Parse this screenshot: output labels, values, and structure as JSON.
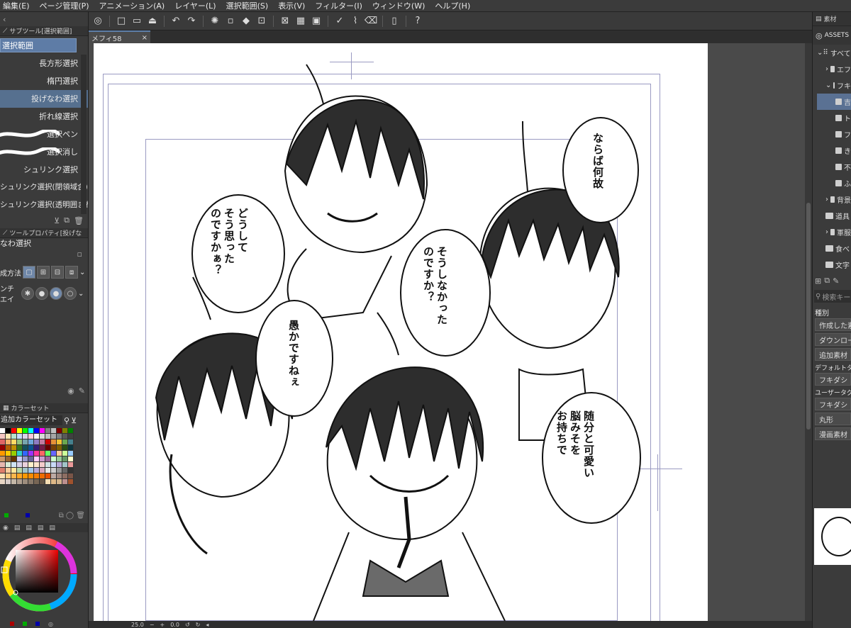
{
  "menu": [
    "編集(E)",
    "ページ管理(P)",
    "アニメーション(A)",
    "レイヤー(L)",
    "選択範囲(S)",
    "表示(V)",
    "フィルター(I)",
    "ウィンドウ(W)",
    "ヘルプ(H)"
  ],
  "toolbar_icons": [
    "logo-icon",
    "new-icon",
    "open-icon",
    "save-icon",
    "undo-icon",
    "redo-icon",
    "spinner-icon",
    "clear-icon",
    "fill-icon",
    "transform-icon",
    "hide-guides-icon",
    "ruler-icon",
    "snap-icon",
    "pen-icon",
    "brush-icon",
    "eraser-icon",
    "smartphone-icon",
    "help-icon"
  ],
  "subtool": {
    "header": "サブツール[選択範囲]",
    "active_group": "選択範囲",
    "items": [
      "長方形選択",
      "楕円選択",
      "投げなわ選択",
      "折れ線選択",
      "選択ペン",
      "選択消し",
      "シュリンク選択",
      "シュリンク選択(閉領域含)",
      "シュリンク選択(透明囲まれ)"
    ],
    "selected_index": 2
  },
  "tool_property": {
    "header": "ツールプロパティ[投げな",
    "title": "なわ選択",
    "row1_label": "成方法",
    "row2_label": "ンチエイ"
  },
  "color_set": {
    "header": "カラーセット",
    "name": "追加カラーセット",
    "colors": [
      "#ffffff",
      "#000000",
      "#ff0000",
      "#ffff00",
      "#00ff00",
      "#00ffff",
      "#0000ff",
      "#ff00ff",
      "#808080",
      "#c0c0c0",
      "#800000",
      "#808000",
      "#008000",
      "#f4c7c3",
      "#fce8b2",
      "#b7e1cd",
      "#c6dafc",
      "#d9d2e9",
      "#f8c8dc",
      "#f2f2f2",
      "#d9d9d9",
      "#bfbfbf",
      "#a6a6a6",
      "#7f7f7f",
      "#595959",
      "#404040",
      "#e06666",
      "#f6b26b",
      "#ffd966",
      "#93c47d",
      "#76a5af",
      "#6fa8dc",
      "#8e7cc3",
      "#c27ba0",
      "#cc0000",
      "#e69138",
      "#f1c232",
      "#6aa84f",
      "#45818e",
      "#990000",
      "#b45f06",
      "#bf9000",
      "#38761d",
      "#134f5c",
      "#0b5394",
      "#351c75",
      "#741b47",
      "#660000",
      "#783f04",
      "#7f6000",
      "#274e13",
      "#0c343d",
      "#ff9900",
      "#ffcc00",
      "#99cc00",
      "#33cccc",
      "#3366ff",
      "#9933ff",
      "#ff3399",
      "#ff6666",
      "#66ff66",
      "#6666ff",
      "#ffcc99",
      "#ccff99",
      "#99ccff",
      "#cc9966",
      "#996633",
      "#663300",
      "#ccccff",
      "#9999cc",
      "#666699",
      "#ffccff",
      "#cc99cc",
      "#996699",
      "#ccffcc",
      "#99cc99",
      "#669966",
      "#ffffcc",
      "#e6b8af",
      "#d9ead3",
      "#cfe2f3",
      "#d9d2e9",
      "#ead1dc",
      "#fff2cc",
      "#fce5cd",
      "#f4cccc",
      "#d0e0e3",
      "#c9daf8",
      "#b4a7d6",
      "#a2c4c9",
      "#ea9999",
      "#dd7e6b",
      "#f9cb9c",
      "#ffe599",
      "#b6d7a8",
      "#a2c4c9",
      "#9fc5e8",
      "#b4a7d6",
      "#d5a6bd",
      "#e6e6e6",
      "#cccccc",
      "#999999",
      "#666666",
      "#333333",
      "#ffe0b2",
      "#ffcc80",
      "#ffb74d",
      "#ffa726",
      "#ff9800",
      "#fb8c00",
      "#f57c00",
      "#ef6c00",
      "#e65100",
      "#bcaaa4",
      "#a1887f",
      "#8d6e63",
      "#795548",
      "#e8d5c4",
      "#d7ccc8",
      "#c5b8a8",
      "#b0a090",
      "#9e8e7e",
      "#8a7a6a",
      "#776655",
      "#655545",
      "#f5deb3",
      "#deb887",
      "#d2b48c",
      "#bc8f8f",
      "#a0522d"
    ]
  },
  "document": {
    "tab_title": "メフィ58"
  },
  "bubbles": {
    "b1": [
      "どうして",
      "そう思った",
      "のですかぁ？"
    ],
    "b2": [
      "ならば何故"
    ],
    "b3": [
      "そうしなかった",
      "のですか？"
    ],
    "b4": [
      "愚かですねぇ"
    ],
    "b5": [
      "随分と可愛い",
      "脳みそを",
      "お持ちで"
    ]
  },
  "status": {
    "zoom": "25.0",
    "angle": "0.0"
  },
  "material_panel": {
    "header": "素材",
    "assets_label": "ASSETS",
    "tree": [
      "すべて",
      "エフ",
      "フキ",
      "吉",
      "ト",
      "フ",
      "き",
      "不",
      "ふ",
      "背景",
      "道具",
      "軍服",
      "食べ",
      "文字"
    ],
    "search_placeholder": "検索キー",
    "kind_label": "種別",
    "buttons": [
      "作成した素",
      "ダウンロー",
      "追加素材"
    ],
    "default_tag_label": "デフォルトタグ",
    "default_tag": "フキダシ",
    "user_tag_label": "ユーザータグ",
    "user_tags": [
      "フキダシ",
      "丸形",
      "漫画素材"
    ]
  }
}
